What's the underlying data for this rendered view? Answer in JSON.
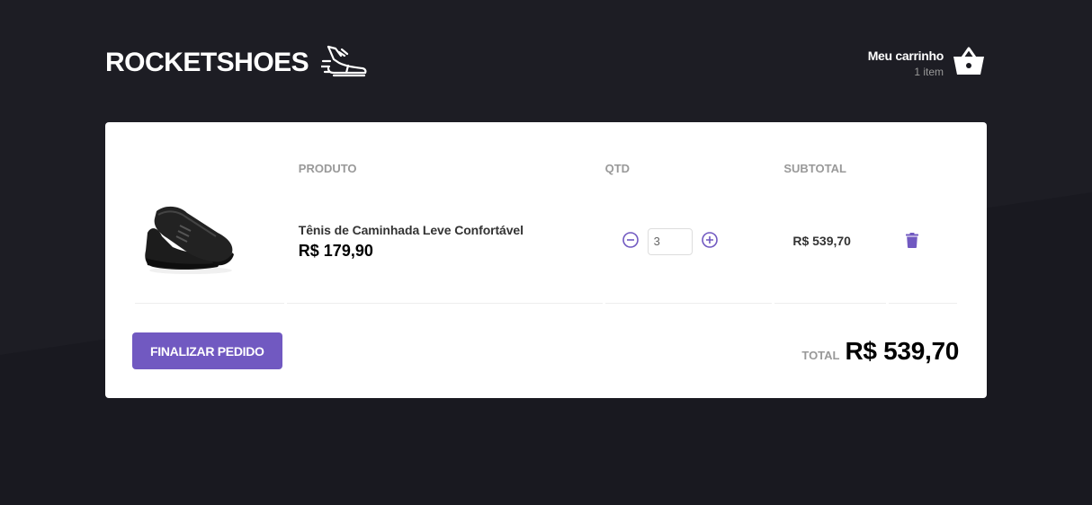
{
  "header": {
    "logo_text": "ROCKETSHOES",
    "cart_title": "Meu carrinho",
    "cart_count": "1 item"
  },
  "table": {
    "columns": [
      "",
      "PRODUTO",
      "QTD",
      "SUBTOTAL",
      ""
    ],
    "rows": [
      {
        "name": "Tênis de Caminhada Leve Confortável",
        "price": "R$ 179,90",
        "quantity": "3",
        "subtotal": "R$ 539,70"
      }
    ]
  },
  "footer": {
    "finish_label": "FINALIZAR PEDIDO",
    "total_label": "TOTAL",
    "total_value": "R$ 539,70"
  },
  "colors": {
    "background": "#191920",
    "accent": "#7159c1",
    "panel": "#ffffff"
  },
  "icons": {
    "logo": "running-shoe-icon",
    "cart": "basket-icon",
    "decrement": "minus-circle-icon",
    "increment": "plus-circle-icon",
    "delete": "trash-icon"
  }
}
